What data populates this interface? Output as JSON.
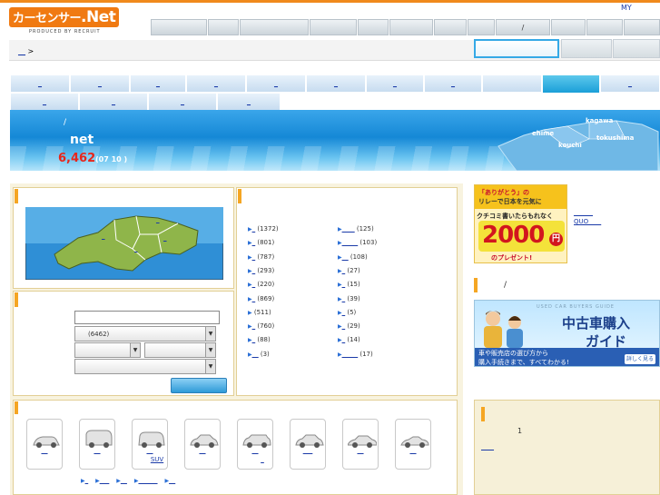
{
  "header": {
    "logo_text": "カーセンサー",
    "logo_net": ".Net",
    "logo_sub": "PRODUCED BY RECRUIT",
    "my_link": "MY",
    "nav_slash": "/"
  },
  "breadcrumb": {
    "link": "__",
    "sep": ">"
  },
  "prefecture_tabs": {
    "row1": [
      "_",
      "_",
      "_",
      "_",
      "_",
      "_",
      "_",
      "_",
      "",
      "_"
    ],
    "row2": [
      "_",
      "_",
      "_",
      "_"
    ]
  },
  "banner": {
    "slash": "/",
    "title": "net",
    "count": "6,462",
    "count_sub": "(07  10      )",
    "islands": [
      "kagawa",
      "ehime",
      "tokushima",
      "kouchi"
    ]
  },
  "stats": {
    "col1": [
      {
        "label": "_",
        "count": "(1372)"
      },
      {
        "label": "_",
        "count": "(801)"
      },
      {
        "label": "_",
        "count": "(787)"
      },
      {
        "label": "_",
        "count": "(293)"
      },
      {
        "label": "_",
        "count": "(220)"
      },
      {
        "label": "_",
        "count": "(869)"
      },
      {
        "label": "",
        "count": "(511)"
      },
      {
        "label": "_",
        "count": "(760)"
      },
      {
        "label": "_",
        "count": "(88)"
      },
      {
        "label": "__",
        "count": "(3)"
      }
    ],
    "col2": [
      {
        "label": "____",
        "count": "(125)"
      },
      {
        "label": "_____",
        "count": "(103)"
      },
      {
        "label": "__",
        "count": "(108)"
      },
      {
        "label": "_",
        "count": "(27)"
      },
      {
        "label": "_",
        "count": "(15)"
      },
      {
        "label": "_",
        "count": "(39)"
      },
      {
        "label": "_",
        "count": "(5)"
      },
      {
        "label": "_",
        "count": "(29)"
      },
      {
        "label": "_",
        "count": "(14)"
      },
      {
        "label": "_____",
        "count": "(17)"
      }
    ]
  },
  "search": {
    "maker_select": "(6462)"
  },
  "car_types": {
    "labels": [
      "__",
      "__",
      "__",
      "__",
      "__",
      "___",
      "__",
      "__"
    ],
    "suv": "SUV",
    "second_line": "_",
    "bottom_links": [
      "_",
      "___",
      "__",
      "______",
      "__"
    ]
  },
  "sidebar": {
    "promo1_line1": "「ありがとう」の",
    "promo1_line2": "リレーで日本を元気に",
    "promo1_line3": "クチコミ書いたらもれなく",
    "promo1_amount": "2000",
    "promo1_yen": "円",
    "promo1_line4": "のプレゼント!",
    "promo1_link1": "______",
    "promo1_link2": "QUO____",
    "section_slash": "/",
    "guide_tag": "中古車購入",
    "guide_title": "ガイド",
    "guide_small": "USED CAR BUYERS GUIDE",
    "guide_text1": "車や販売店の選び方から",
    "guide_text2": "購入手続きまで、すべてわかる!",
    "guide_more": "詳しく見る",
    "box_number": "1",
    "box_link": "____"
  },
  "colors": {
    "accent": "#f08a1c",
    "tab_active": "#1b9fd8",
    "count_red": "#e8251a"
  }
}
